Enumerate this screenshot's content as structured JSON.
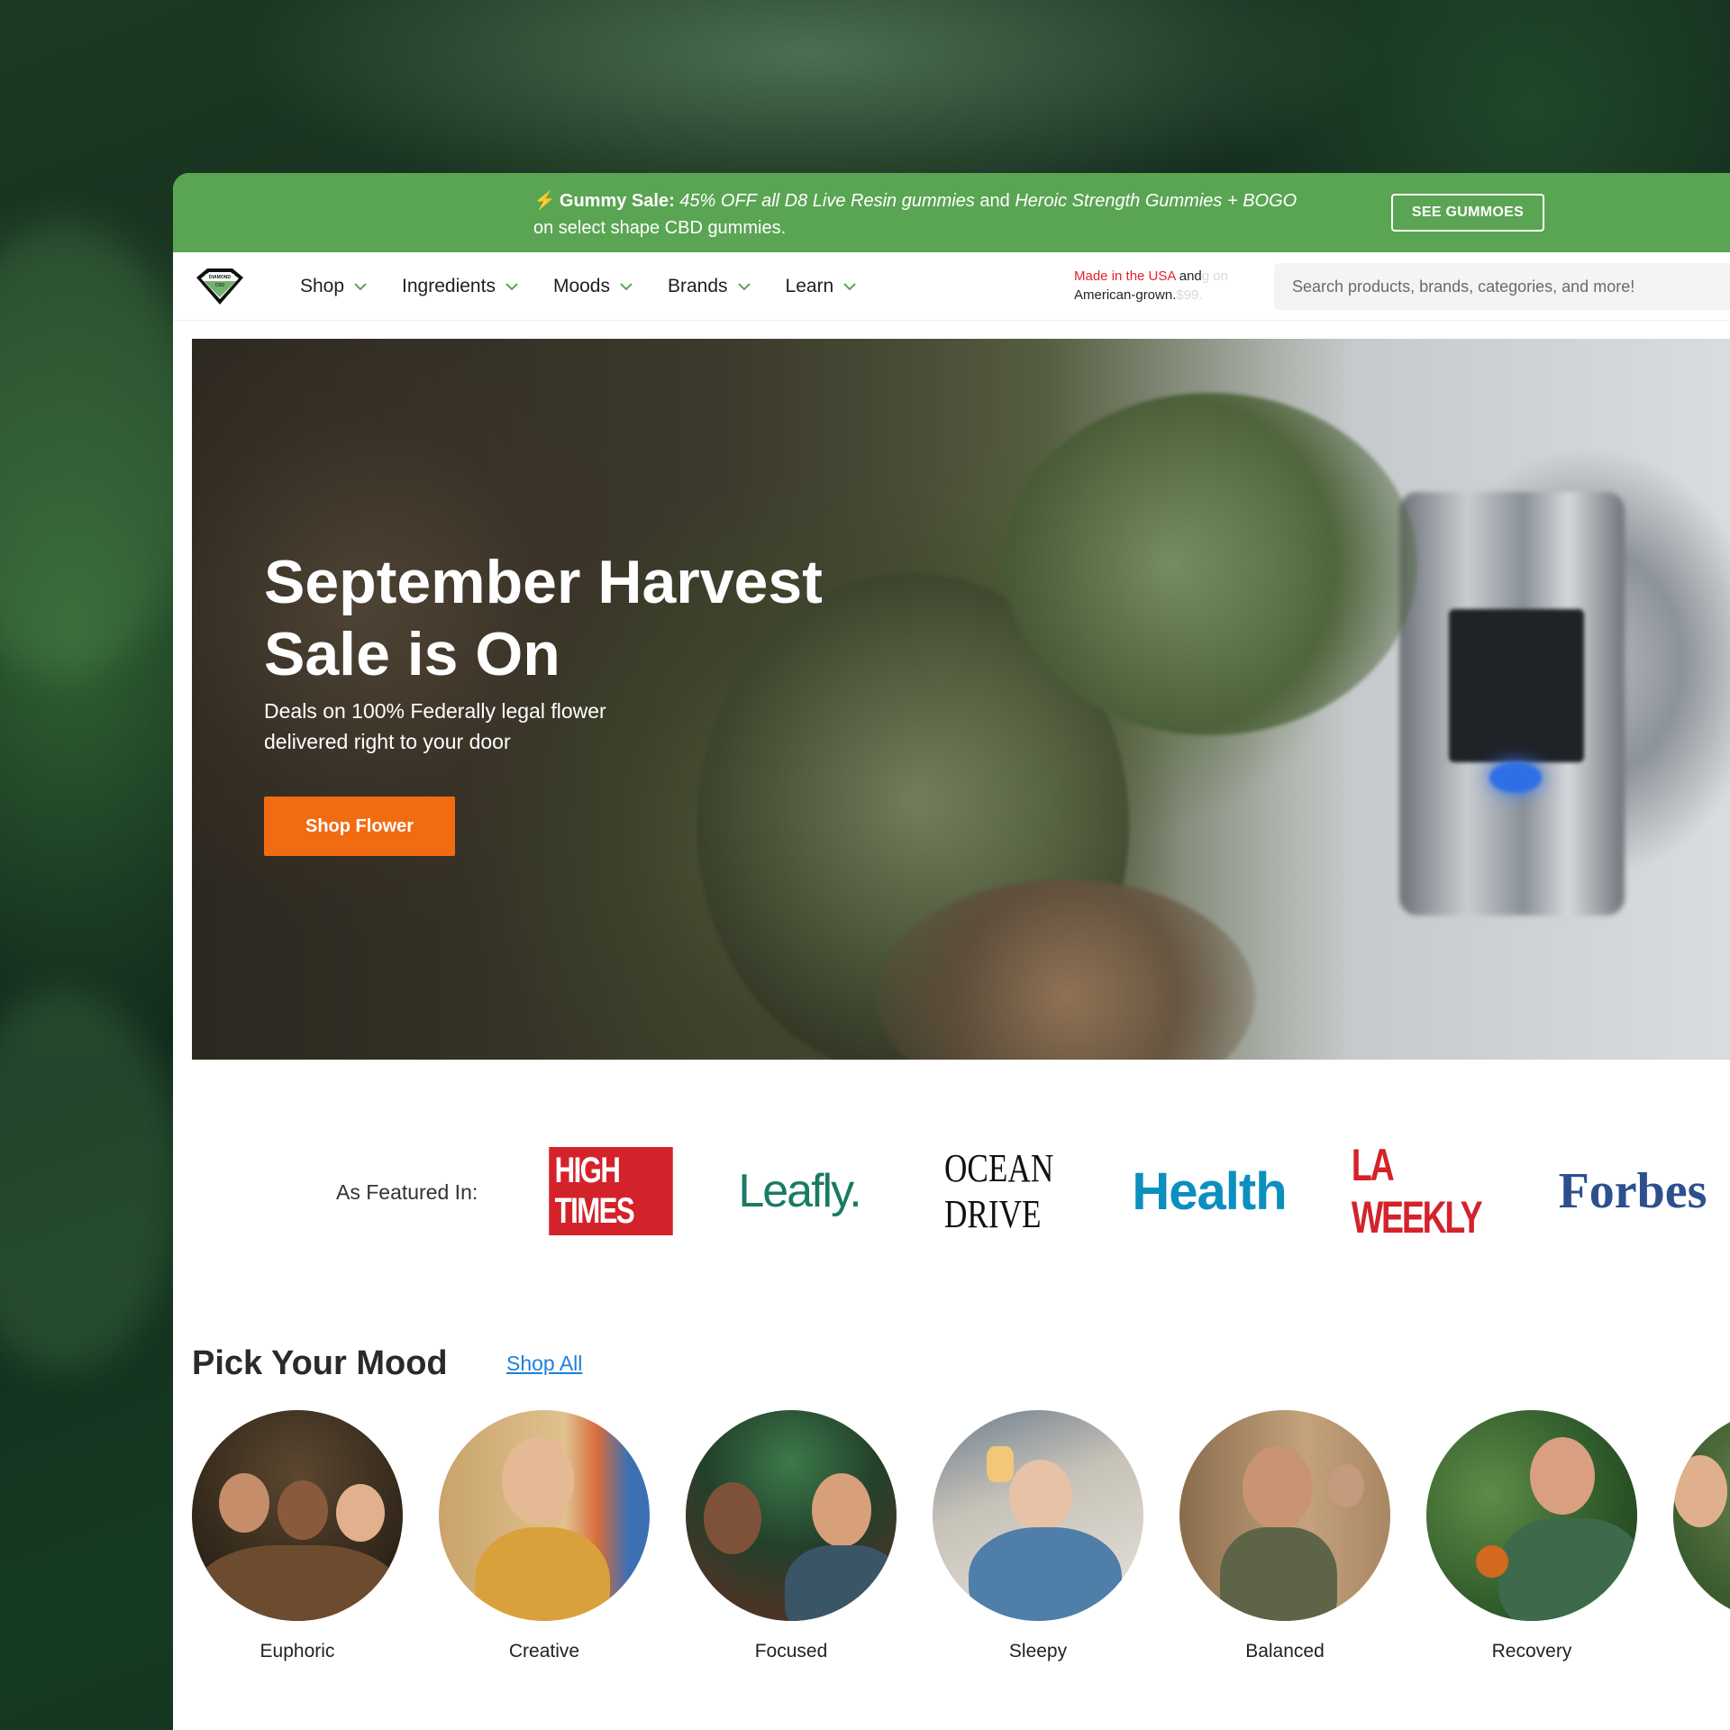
{
  "promo": {
    "bolt": "⚡",
    "lead": "Gummy Sale:",
    "part1": "45% OFF all D8 Live Resin gummies",
    "and": "and",
    "part2": "Heroic Strength Gummies + BOGO",
    "part3": "on select shape CBD gummies.",
    "button": "SEE GUMMOES"
  },
  "nav": {
    "items": [
      {
        "label": "Shop"
      },
      {
        "label": "Ingredients"
      },
      {
        "label": "Moods"
      },
      {
        "label": "Brands"
      },
      {
        "label": "Learn"
      }
    ],
    "made_usa_red": "Made in the USA",
    "made_usa_and": "and",
    "made_usa_faded1": "g on",
    "made_usa_line2": "American-grown.",
    "made_usa_faded2": "$99.",
    "search_placeholder": "Search products, brands, categories, and more!"
  },
  "hero": {
    "title": "September Harvest Sale is On",
    "subtitle": "Deals on 100% Federally legal flower delivered right to your door",
    "button": "Shop Flower"
  },
  "featured": {
    "label": "As Featured In:",
    "logos": [
      "HIGH TIMES",
      "Leafly.",
      "OCEAN DRIVE",
      "Health",
      "LA WEEKLY",
      "Forbes"
    ]
  },
  "moods": {
    "title": "Pick Your Mood",
    "shop_all": "Shop All",
    "items": [
      {
        "label": "Euphoric"
      },
      {
        "label": "Creative"
      },
      {
        "label": "Focused"
      },
      {
        "label": "Sleepy"
      },
      {
        "label": "Balanced"
      },
      {
        "label": "Recovery"
      },
      {
        "label": ""
      }
    ]
  },
  "colors": {
    "promo_green": "#5aa553",
    "cta_orange": "#f26b12",
    "link_blue": "#1e7fd8",
    "nav_chevron": "#5aa553"
  }
}
